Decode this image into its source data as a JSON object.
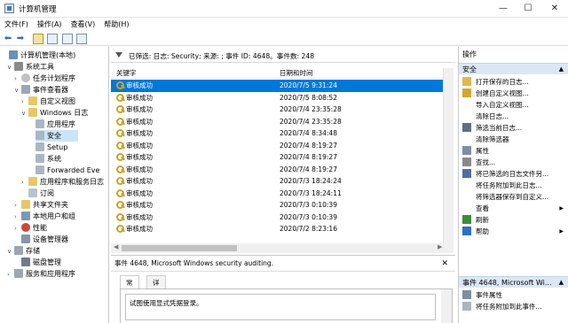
{
  "window": {
    "title": "计算机管理",
    "minimize": "—",
    "maximize": "☐",
    "close": "✕"
  },
  "menu": [
    "文件(F)",
    "操作(A)",
    "查看(V)",
    "帮助(H)"
  ],
  "tree": {
    "items": [
      {
        "label": "计算机管理(本地)",
        "expander": "",
        "icon": "computer-icon"
      },
      {
        "label": "系统工具",
        "expander": "∨",
        "icon": "tools-icon"
      },
      {
        "label": "任务计划程序",
        "expander": "›",
        "icon": "clock-icon"
      },
      {
        "label": "事件查看器",
        "expander": "∨",
        "icon": "event-viewer-icon"
      },
      {
        "label": "自定义视图",
        "expander": "›",
        "icon": "folder-icon"
      },
      {
        "label": "Windows 日志",
        "expander": "∨",
        "icon": "folder-icon"
      },
      {
        "label": "应用程序",
        "expander": "",
        "icon": "log-icon"
      },
      {
        "label": "安全",
        "expander": "",
        "icon": "log-icon"
      },
      {
        "label": "Setup",
        "expander": "",
        "icon": "log-icon"
      },
      {
        "label": "系统",
        "expander": "",
        "icon": "log-icon"
      },
      {
        "label": "Forwarded Eve",
        "expander": "",
        "icon": "log-icon"
      },
      {
        "label": "应用程序和服务日志",
        "expander": "›",
        "icon": "folder-icon"
      },
      {
        "label": "订阅",
        "expander": "",
        "icon": "subscription-icon"
      },
      {
        "label": "共享文件夹",
        "expander": "›",
        "icon": "shared-folder-icon"
      },
      {
        "label": "本地用户和组",
        "expander": "›",
        "icon": "users-icon"
      },
      {
        "label": "性能",
        "expander": "›",
        "icon": "performance-icon"
      },
      {
        "label": "设备管理器",
        "expander": "",
        "icon": "device-manager-icon"
      },
      {
        "label": "存储",
        "expander": "∨",
        "icon": "storage-icon"
      },
      {
        "label": "磁盘管理",
        "expander": "",
        "icon": "disk-icon"
      },
      {
        "label": "服务和应用程序",
        "expander": "›",
        "icon": "services-icon"
      }
    ]
  },
  "filter_text": "已筛选: 日志: Security; 来源: ; 事件 ID: 4648。事件数: 248",
  "grid": {
    "columns": [
      "关键字",
      "日期和时间"
    ],
    "rows": [
      {
        "keyword": "审核成功",
        "datetime": "2020/7/5 9:31:24"
      },
      {
        "keyword": "审核成功",
        "datetime": "2020/7/5 8:08:52"
      },
      {
        "keyword": "审核成功",
        "datetime": "2020/7/4 23:35:28"
      },
      {
        "keyword": "审核成功",
        "datetime": "2020/7/4 23:35:28"
      },
      {
        "keyword": "审核成功",
        "datetime": "2020/7/4 8:34:48"
      },
      {
        "keyword": "审核成功",
        "datetime": "2020/7/4 8:19:27"
      },
      {
        "keyword": "审核成功",
        "datetime": "2020/7/4 8:19:27"
      },
      {
        "keyword": "审核成功",
        "datetime": "2020/7/4 8:19:27"
      },
      {
        "keyword": "审核成功",
        "datetime": "2020/7/3 18:24:24"
      },
      {
        "keyword": "审核成功",
        "datetime": "2020/7/3 18:24:11"
      },
      {
        "keyword": "审核成功",
        "datetime": "2020/7/3 0:10:39"
      },
      {
        "keyword": "审核成功",
        "datetime": "2020/7/3 0:10:39"
      },
      {
        "keyword": "审核成功",
        "datetime": "2020/7/2 8:23:16"
      }
    ]
  },
  "detail": {
    "header": "事件 4648, Microsoft Windows security auditing.",
    "close": "✕",
    "tabs": [
      "常规",
      "详细信息"
    ],
    "message": "试图使用显式凭据登录。"
  },
  "actions": {
    "header": "操作",
    "section1": "安全",
    "items1": [
      {
        "label": "打开保存的日志...",
        "icon": "open-log-icon"
      },
      {
        "label": "创建自定义视图...",
        "icon": "create-view-icon"
      },
      {
        "label": "导入自定义视图...",
        "icon": ""
      },
      {
        "label": "清除日志...",
        "icon": ""
      },
      {
        "label": "筛选当前日志...",
        "icon": "filter-icon"
      },
      {
        "label": "清除筛选器",
        "icon": ""
      },
      {
        "label": "属性",
        "icon": "properties-icon"
      },
      {
        "label": "查找...",
        "icon": "find-icon"
      },
      {
        "label": "将已筛选的日志文件另...",
        "icon": "save-icon"
      },
      {
        "label": "将任务附加到此日志...",
        "icon": ""
      },
      {
        "label": "将筛选器保存到自定义...",
        "icon": ""
      },
      {
        "label": "查看",
        "icon": "",
        "submenu": "▶"
      },
      {
        "label": "刷新",
        "icon": "refresh-icon"
      },
      {
        "label": "帮助",
        "icon": "help-icon",
        "submenu": "▶"
      }
    ],
    "section2": "事件 4648, Microsoft Wi...",
    "items2": [
      {
        "label": "事件属性",
        "icon": "event-properties-icon"
      },
      {
        "label": "将任务附加到此事件...",
        "icon": "attach-task-icon"
      }
    ]
  }
}
